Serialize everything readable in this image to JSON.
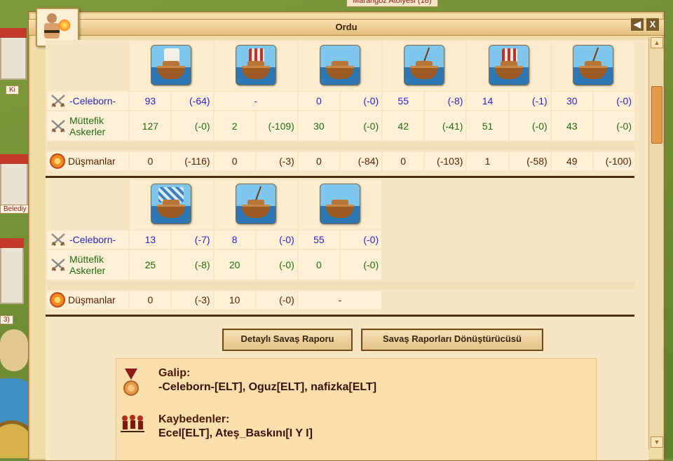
{
  "map": {
    "top_label": "Marangoz Atölyesi (18)",
    "left_labels": [
      "Ki",
      "Belediy",
      "3)"
    ]
  },
  "window": {
    "title": "Ordu",
    "back_glyph": "◀",
    "close_glyph": "X"
  },
  "labels": {
    "player": "-Celeborn-",
    "allies_line1": "Müttefik",
    "allies_line2": "Askerler",
    "enemies": "Düşmanlar"
  },
  "battle1": {
    "units": [
      {
        "icon": "light-ship-icon",
        "sail": "white"
      },
      {
        "icon": "fire-ship-icon",
        "sail": "red"
      },
      {
        "icon": "transport-boat-icon",
        "sail": "none"
      },
      {
        "icon": "bireme-icon",
        "sail": "none"
      },
      {
        "icon": "trireme-icon",
        "sail": "red"
      },
      {
        "icon": "catapult-ship-icon",
        "sail": "none"
      }
    ],
    "player": [
      [
        "93",
        "(-64)"
      ],
      [
        "-",
        ""
      ],
      [
        "0",
        "(-0)"
      ],
      [
        "55",
        "(-8)"
      ],
      [
        "14",
        "(-1)"
      ],
      [
        "30",
        "(-0)"
      ]
    ],
    "allies": [
      [
        "127",
        "(-0)"
      ],
      [
        "2",
        "(-109)"
      ],
      [
        "30",
        "(-0)"
      ],
      [
        "42",
        "(-41)"
      ],
      [
        "51",
        "(-0)"
      ],
      [
        "43",
        "(-0)"
      ]
    ],
    "enemies": [
      [
        "0",
        "(-116)"
      ],
      [
        "0",
        "(-3)"
      ],
      [
        "0",
        "(-84)"
      ],
      [
        "0",
        "(-103)"
      ],
      [
        "1",
        "(-58)"
      ],
      [
        "49",
        "(-100)"
      ]
    ]
  },
  "battle2": {
    "units": [
      {
        "icon": "colony-ship-icon",
        "sail": "blue"
      },
      {
        "icon": "demolition-ship-icon",
        "sail": "none"
      },
      {
        "icon": "fast-transport-icon",
        "sail": "none"
      }
    ],
    "player": [
      [
        "13",
        "(-7)"
      ],
      [
        "8",
        "(-0)"
      ],
      [
        "55",
        "(-0)"
      ]
    ],
    "allies": [
      [
        "25",
        "(-8)"
      ],
      [
        "20",
        "(-0)"
      ],
      [
        "0",
        "(-0)"
      ]
    ],
    "enemies": [
      [
        "0",
        "(-3)"
      ],
      [
        "10",
        "(-0)"
      ],
      [
        "-",
        ""
      ]
    ]
  },
  "buttons": {
    "detail": "Detaylı Savaş Raporu",
    "convert": "Savaş Raporları Dönüştürücüsü"
  },
  "result": {
    "winners_title": "Galip:",
    "winners": "-Celeborn-[ELT], Oguz[ELT], nafizka[ELT]",
    "losers_title": "Kaybedenler:",
    "losers": "Ecel[ELT], Ateş_Baskını[I Y I]"
  },
  "colors": {
    "player_text": "#2b24c8",
    "ally_text": "#1f6b10",
    "enemy_text": "#5a2000",
    "window_bg": "#f1dcaa"
  }
}
